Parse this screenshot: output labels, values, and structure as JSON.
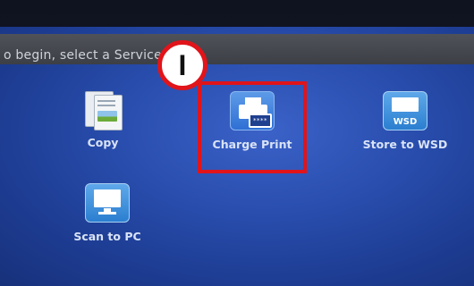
{
  "topbar": {
    "instruction": "o begin, select a Service."
  },
  "services": [
    {
      "id": "copy",
      "label": "Copy",
      "icon": "copy-document-icon"
    },
    {
      "id": "charge_print",
      "label": "Charge Print",
      "icon": "printer-card-icon"
    },
    {
      "id": "store_to_wsd",
      "label": "Store to WSD",
      "icon": "monitor-wsd-icon",
      "icon_text": "WSD"
    },
    {
      "id": "scan_to_pc",
      "label": "Scan to PC",
      "icon": "monitor-icon"
    }
  ],
  "annotation": {
    "step_number": "I",
    "color": "#e0141a"
  },
  "colors": {
    "screen": "#2a4fb0",
    "topbar": "#4f5258",
    "highlight": "#e0141a"
  }
}
